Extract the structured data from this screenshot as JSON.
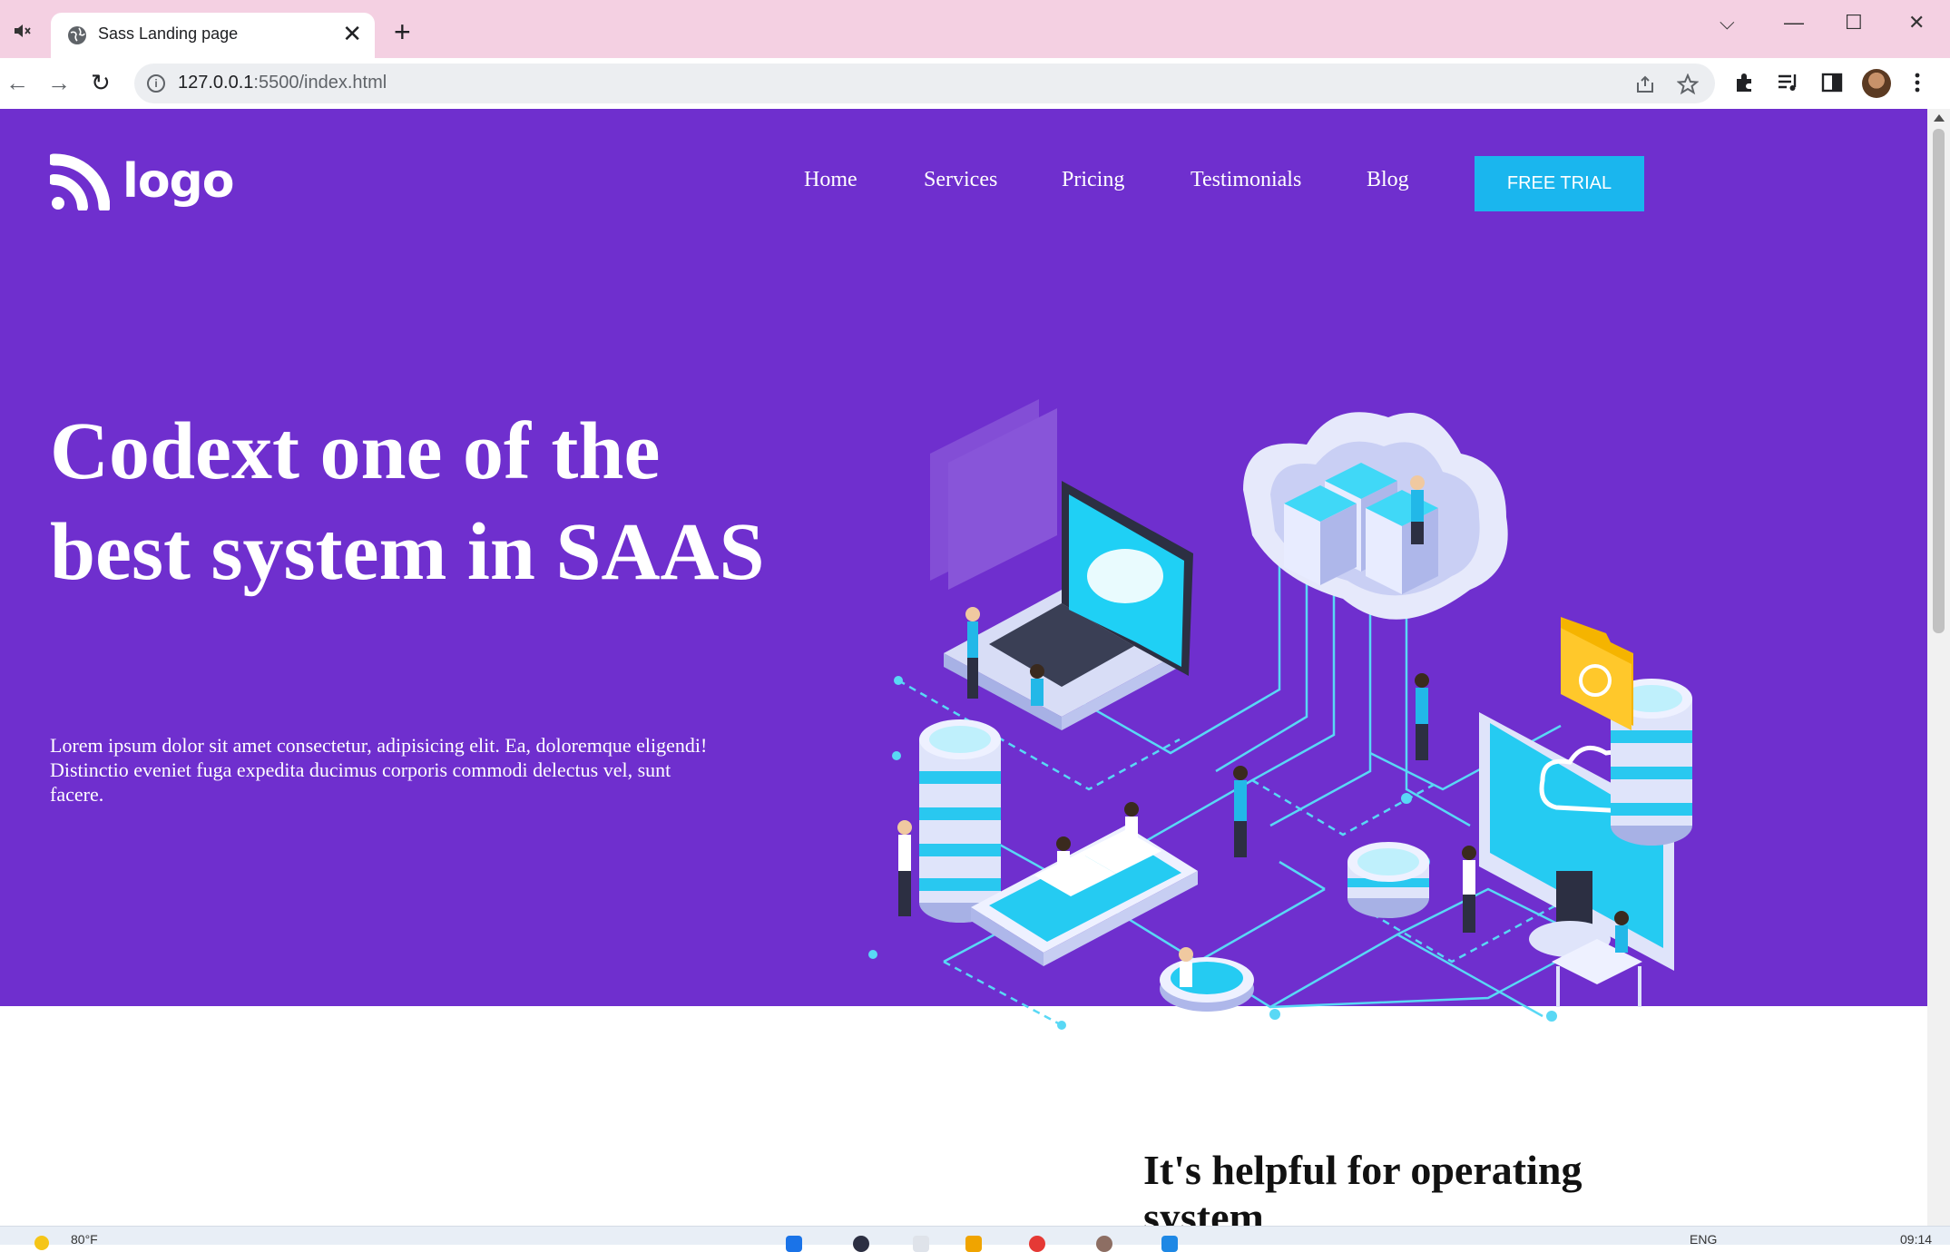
{
  "browser": {
    "tab_title": "Sass Landing page",
    "tab_close": "✕",
    "new_tab": "+",
    "url_host": "127.0.0.1",
    "url_rest": ":5500/index.html",
    "window_controls": {
      "dropdown": "⌵",
      "minimize": "—",
      "maximize": "☐",
      "close": "✕"
    },
    "nav": {
      "back": "←",
      "forward": "→",
      "reload": "↻"
    }
  },
  "site": {
    "logo_text": "logo",
    "nav_items": [
      "Home",
      "Services",
      "Pricing",
      "Testimonials",
      "Blog"
    ],
    "cta_label": "FREE TRIAL",
    "headline": "Codext one of the best system in SAAS",
    "lead": "Lorem ipsum dolor sit amet consectetur, adipisicing elit. Ea, doloremque eligendi! Distinctio eveniet fuga expedita ducimus corporis commodi delectus vel, sunt facere.",
    "section_title": "It's helpful for operating system"
  },
  "taskbar": {
    "weather": "80°F",
    "language": "ENG",
    "time": "09:14"
  },
  "colors": {
    "hero_bg": "#6f2fce",
    "cta_bg": "#1ab6ee",
    "tab_strip": "#f4d0e2"
  }
}
